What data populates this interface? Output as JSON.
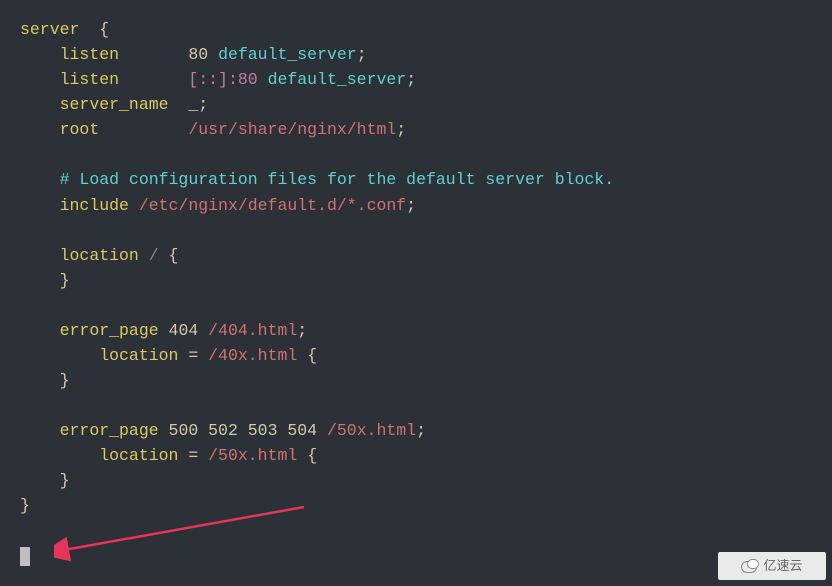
{
  "code": {
    "server": "server",
    "listen": "listen",
    "port80": "80",
    "default_server": "default_server",
    "listen_ipv6": "[::]:80",
    "server_name": "server_name",
    "underscore": "_",
    "root": "root",
    "root_path": "/usr/share/nginx/html",
    "comment": "# Load configuration files for the default server block.",
    "include": "include",
    "include_path": "/etc/nginx/default.d/*.conf",
    "location": "location",
    "slash": "/",
    "error_page": "error_page",
    "code404": "404",
    "path404": "/404.html",
    "eq": "=",
    "path40x": "/40x.html",
    "codes5xx": "500 502 503 504",
    "path50x": "/50x.html",
    "path50x_loc": "/50x.html",
    "brace_open": "{",
    "brace_close": "}",
    "semi": ";"
  },
  "watermark": "亿速云"
}
